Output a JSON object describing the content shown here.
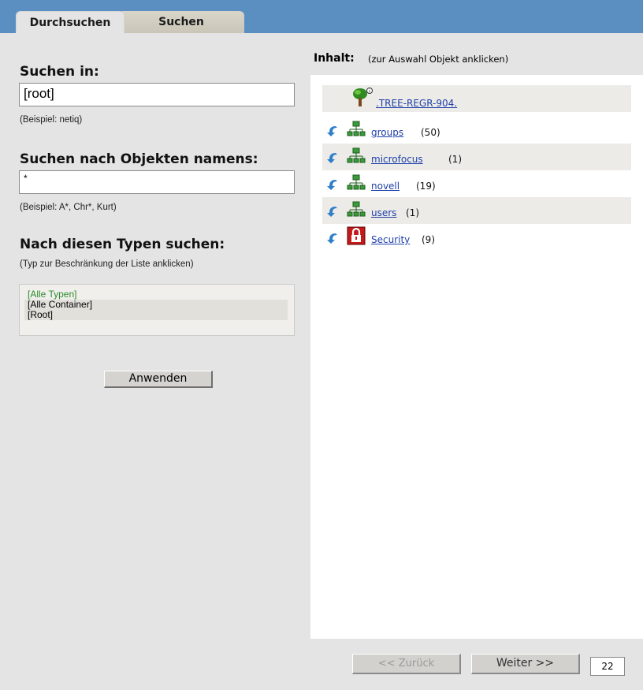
{
  "tabs": [
    {
      "label": "Durchsuchen",
      "active": true
    },
    {
      "label": "Suchen",
      "active": false
    }
  ],
  "search_in": {
    "heading": "Suchen in:",
    "value": "[root]",
    "hint": "(Beispiel: netiq)"
  },
  "search_names": {
    "heading": "Suchen nach Objekten namens:",
    "value": "*",
    "hint": "(Beispiel: A*, Chr*, Kurt)"
  },
  "types": {
    "heading": "Nach diesen Typen suchen:",
    "hint": "(Typ zur Beschränkung der Liste anklicken)",
    "items": [
      "[Alle Typen]",
      "[Alle Container]",
      "[Root]"
    ]
  },
  "apply_button": "Anwenden",
  "content": {
    "heading": "Inhalt:",
    "subheading": "(zur Auswahl Objekt anklicken)",
    "tree": {
      "label": ".TREE-REGR-904.",
      "icon": "tree-icon"
    },
    "items": [
      {
        "label": "groups",
        "count": "(50)",
        "icon": "container-icon"
      },
      {
        "label": "microfocus",
        "count": "(1)",
        "icon": "container-icon"
      },
      {
        "label": "novell",
        "count": "(19)",
        "icon": "container-icon"
      },
      {
        "label": "users",
        "count": "(1)",
        "icon": "container-icon"
      },
      {
        "label": "Security",
        "count": "(9)",
        "icon": "security-icon"
      }
    ]
  },
  "pagination": {
    "prev": "<< Zurück",
    "next": "Weiter >>",
    "page_size": "22"
  },
  "colors": {
    "topbar": "#5b8fc2",
    "link": "#1f3fa8",
    "selected_type": "#2e8b2e"
  }
}
